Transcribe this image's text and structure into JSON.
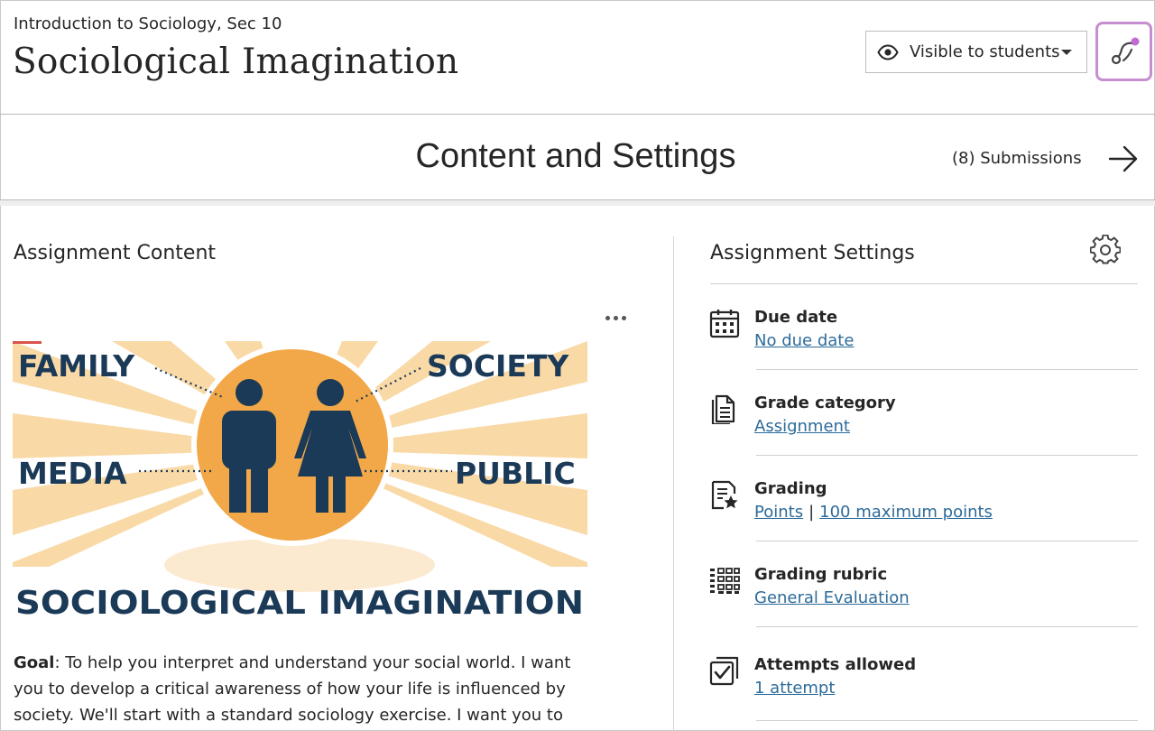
{
  "header": {
    "course_name": "Introduction to Sociology, Sec 10",
    "page_title": "Sociological Imagination",
    "visibility_label": "Visible to students"
  },
  "band": {
    "title": "Content and Settings",
    "submissions_label": "(8) Submissions"
  },
  "content": {
    "heading": "Assignment Content",
    "image_words": {
      "family": "FAMILY",
      "society": "SOCIETY",
      "media": "MEDIA",
      "public": "PUBLIC",
      "banner": "SOCIOLOGICAL IMAGINATION"
    },
    "goal_label": "Goal",
    "goal_text": ": To help you interpret and understand your social world. I want you to develop a critical awareness of how your life is influenced by society. We'll start with a standard sociology exercise. I want you to"
  },
  "settings": {
    "heading": "Assignment Settings",
    "items": [
      {
        "title": "Due date",
        "value": "No due date",
        "icon": "calendar-icon"
      },
      {
        "title": "Grade category",
        "value": "Assignment",
        "icon": "document-icon"
      },
      {
        "title": "Grading",
        "value": "Points",
        "value2": "100 maximum points",
        "separator": "|",
        "icon": "grading-star-icon"
      },
      {
        "title": "Grading rubric",
        "value": "General Evaluation",
        "icon": "rubric-grid-icon"
      },
      {
        "title": "Attempts allowed",
        "value": "1 attempt",
        "icon": "attempts-check-icon"
      }
    ]
  },
  "colors": {
    "link": "#2d6b9a",
    "ai_border": "#c58ed0",
    "ai_dot": "#c06cd0",
    "image_navy": "#1b3a57",
    "image_orange": "#f2a848",
    "image_ray": "#f9d9a6"
  }
}
